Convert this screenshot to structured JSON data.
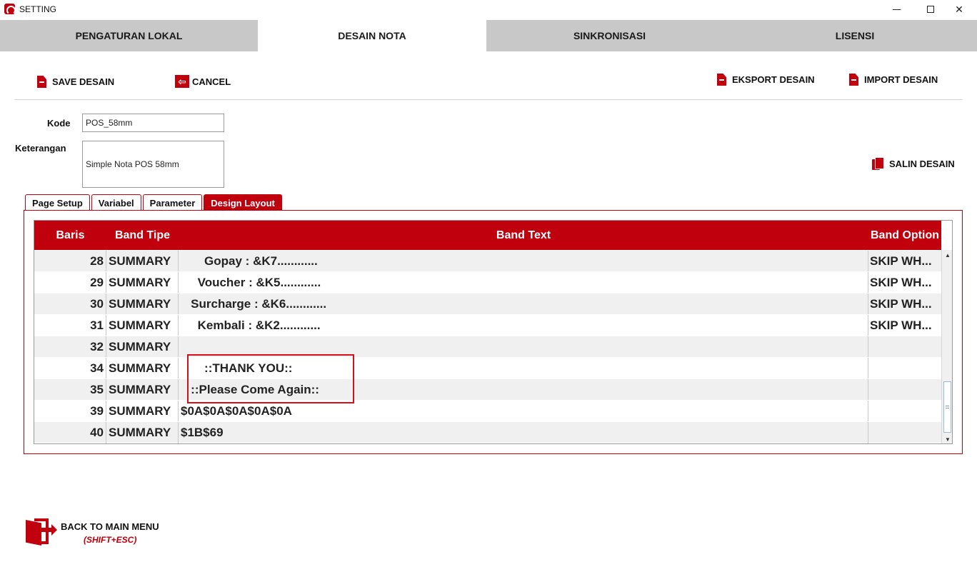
{
  "window": {
    "title": "SETTING",
    "controls": {
      "minimize": "",
      "maximize": "",
      "close": "✕"
    }
  },
  "main_tabs": [
    {
      "label": "PENGATURAN LOKAL",
      "active": false
    },
    {
      "label": "DESAIN NOTA",
      "active": true
    },
    {
      "label": "SINKRONISASI",
      "active": false
    },
    {
      "label": "LISENSI",
      "active": false
    }
  ],
  "toolbar": {
    "save_label": "SAVE DESAIN",
    "cancel_label": "CANCEL",
    "export_label": "EKSPORT DESAIN",
    "import_label": "IMPORT DESAIN",
    "copy_label": "SALIN DESAIN",
    "cancel_glyph": "⇦"
  },
  "form": {
    "kode_label": "Kode",
    "kode_value": "POS_58mm",
    "keterangan_label": "Keterangan",
    "keterangan_value": "Simple Nota POS 58mm"
  },
  "sub_tabs": [
    {
      "label": "Page Setup",
      "active": false
    },
    {
      "label": "Variabel",
      "active": false
    },
    {
      "label": "Parameter",
      "active": false
    },
    {
      "label": "Design Layout",
      "active": true
    }
  ],
  "table": {
    "headers": {
      "baris": "Baris",
      "band_tipe": "Band Tipe",
      "band_text": "Band Text",
      "band_option": "Band Option"
    },
    "rows": [
      {
        "baris": "28",
        "tipe": "SUMMARY",
        "text": "       Gopay : &K7............",
        "option": "SKIP WH..."
      },
      {
        "baris": "29",
        "tipe": "SUMMARY",
        "text": "     Voucher : &K5............",
        "option": "SKIP WH..."
      },
      {
        "baris": "30",
        "tipe": "SUMMARY",
        "text": "   Surcharge : &K6............",
        "option": "SKIP WH..."
      },
      {
        "baris": "31",
        "tipe": "SUMMARY",
        "text": "     Kembali : &K2............",
        "option": "SKIP WH..."
      },
      {
        "baris": "32",
        "tipe": "SUMMARY",
        "text": "",
        "option": ""
      },
      {
        "baris": "34",
        "tipe": "SUMMARY",
        "text": "       ::THANK YOU::",
        "option": ""
      },
      {
        "baris": "35",
        "tipe": "SUMMARY",
        "text": "   ::Please Come Again::",
        "option": ""
      },
      {
        "baris": "39",
        "tipe": "SUMMARY",
        "text": "$0A$0A$0A$0A$0A",
        "option": ""
      },
      {
        "baris": "40",
        "tipe": "SUMMARY",
        "text": "$1B$69",
        "option": ""
      }
    ]
  },
  "scrollbar": {
    "up_glyph": "▲",
    "down_glyph": "▼"
  },
  "back": {
    "label": "BACK TO MAIN MENU",
    "shortcut": "(SHIFT+ESC)"
  },
  "colors": {
    "accent": "#c0000c",
    "header_text": "#ffffff",
    "tab_inactive": "#c8c8c8"
  }
}
